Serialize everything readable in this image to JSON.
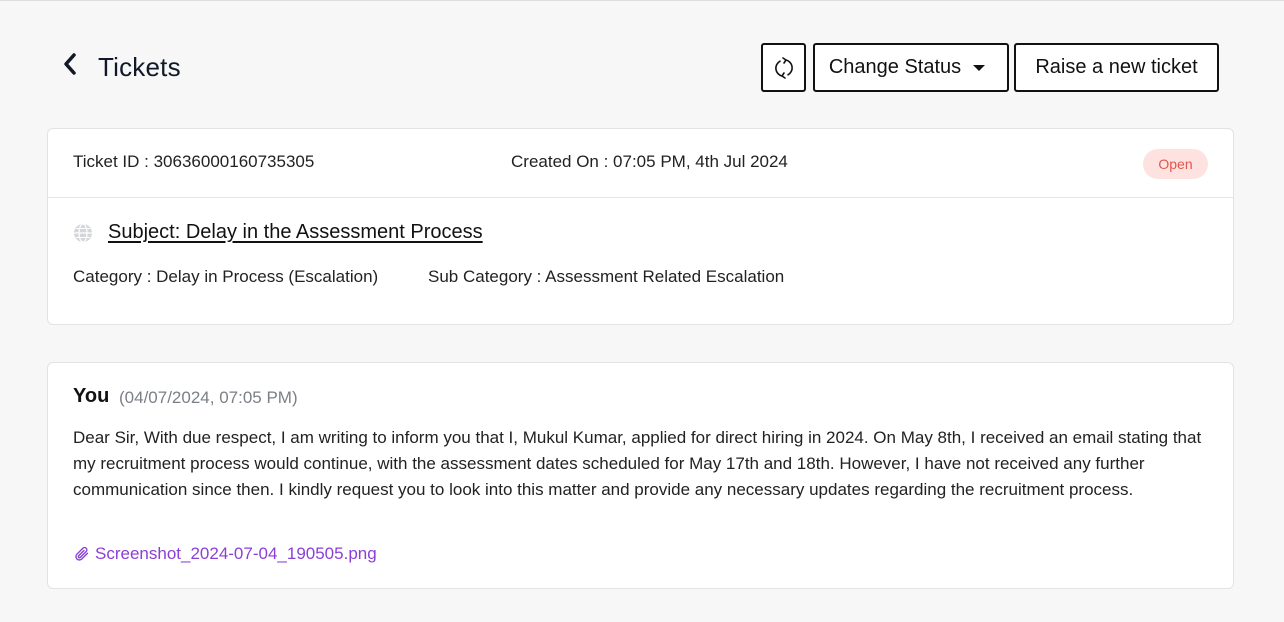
{
  "page": {
    "title": "Tickets"
  },
  "toolbar": {
    "refresh_icon": "refresh-icon",
    "change_status_label": "Change Status",
    "new_ticket_label": "Raise a new ticket"
  },
  "ticket": {
    "id_text": "Ticket ID : 30636000160735305",
    "created_text": "Created On : 07:05 PM, 4th Jul 2024",
    "status": "Open",
    "subject": "Subject: Delay in the Assessment Process",
    "category": "Category : Delay in Process (Escalation)",
    "sub_category": "Sub Category : Assessment Related Escalation"
  },
  "message": {
    "author": "You",
    "timestamp": "(04/07/2024, 07:05 PM)",
    "body": "Dear Sir, With due respect, I am writing to inform you that I, Mukul Kumar, applied for direct hiring in 2024. On May 8th, I received an email stating that my recruitment process would continue, with the assessment dates scheduled for May 17th and 18th. However, I have not received any further communication since then. I kindly request you to look into this matter and provide any necessary updates regarding the recruitment process.",
    "attachment": "Screenshot_2024-07-04_190505.png"
  },
  "colors": {
    "background": "#f7f7f7",
    "badge_bg": "#fde2e0",
    "badge_text": "#e2574c",
    "attachment_link": "#8b3fd9"
  }
}
